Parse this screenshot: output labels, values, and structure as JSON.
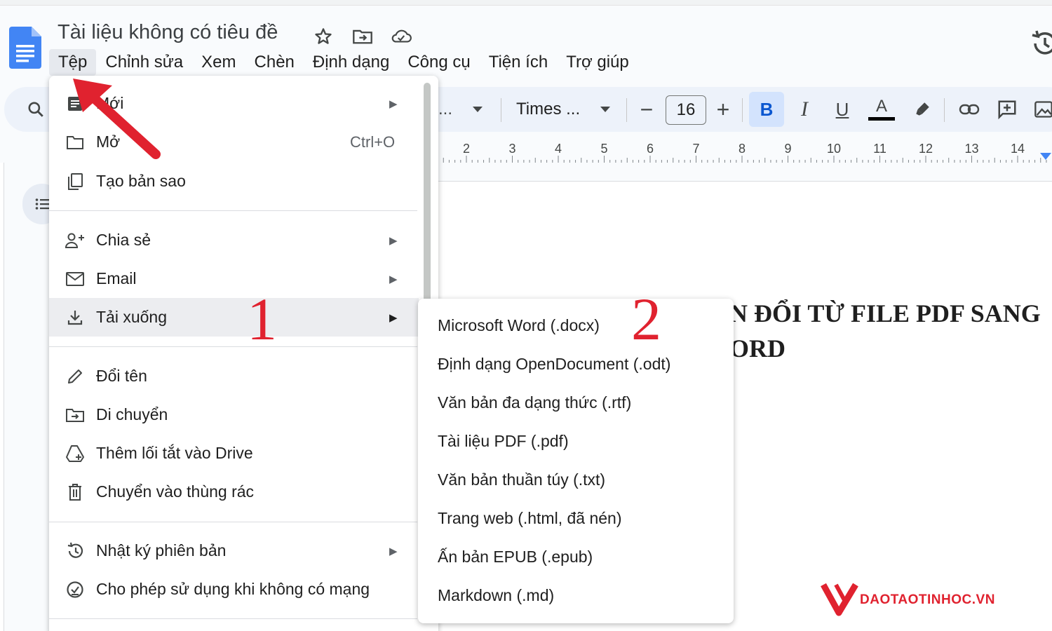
{
  "document": {
    "title": "Tài liệu không có tiêu đề",
    "heading_line1": "N ĐỔI TỪ FILE PDF SANG",
    "heading_line2": "ORD"
  },
  "menubar": {
    "items": [
      "Tệp",
      "Chỉnh sửa",
      "Xem",
      "Chèn",
      "Định dạng",
      "Công cụ",
      "Tiện ích",
      "Trợ giúp"
    ]
  },
  "toolbar": {
    "style_value": "...",
    "font_value": "Times ...",
    "font_size": "16",
    "minus": "−",
    "plus": "+",
    "bold": "B",
    "italic": "I",
    "underline": "U",
    "text_color": "A",
    "text_color_hex": "#000000"
  },
  "ruler": {
    "numbers": [
      "2",
      "3",
      "4",
      "5",
      "6",
      "7",
      "8",
      "9",
      "10",
      "11",
      "12",
      "13",
      "14"
    ]
  },
  "file_menu": {
    "items": [
      {
        "label": "Mới",
        "icon": "new-doc-icon",
        "submenu": true
      },
      {
        "label": "Mở",
        "icon": "folder-icon",
        "shortcut": "Ctrl+O"
      },
      {
        "label": "Tạo bản sao",
        "icon": "copy-icon"
      },
      {
        "label": "Chia sẻ",
        "icon": "share-person-icon",
        "submenu": true
      },
      {
        "label": "Email",
        "icon": "email-icon",
        "submenu": true
      },
      {
        "label": "Tải xuống",
        "icon": "download-icon",
        "submenu": true,
        "highlighted": true
      },
      {
        "label": "Đổi tên",
        "icon": "pencil-icon"
      },
      {
        "label": "Di chuyển",
        "icon": "move-folder-icon"
      },
      {
        "label": "Thêm lối tắt vào Drive",
        "icon": "drive-shortcut-icon"
      },
      {
        "label": "Chuyển vào thùng rác",
        "icon": "trash-icon"
      },
      {
        "label": "Nhật ký phiên bản",
        "icon": "history-icon",
        "submenu": true
      },
      {
        "label": "Cho phép sử dụng khi không có mạng",
        "icon": "offline-icon"
      }
    ]
  },
  "download_submenu": {
    "items": [
      "Microsoft Word (.docx)",
      "Định dạng OpenDocument (.odt)",
      "Văn bản đa dạng thức (.rtf)",
      "Tài liệu PDF (.pdf)",
      "Văn bản thuần túy (.txt)",
      "Trang web (.html, đã nén)",
      "Ấn bản EPUB (.epub)",
      "Markdown (.md)"
    ]
  },
  "annotations": {
    "step1": "1",
    "step2": "2",
    "color": "#e0222f"
  },
  "watermark": {
    "text": "DAOTAOTINHOC.VN"
  },
  "colors": {
    "docs_blue": "#4285f4",
    "toolbar_bg": "#edf2fa",
    "bold_active_bg": "#d3e3fd"
  }
}
